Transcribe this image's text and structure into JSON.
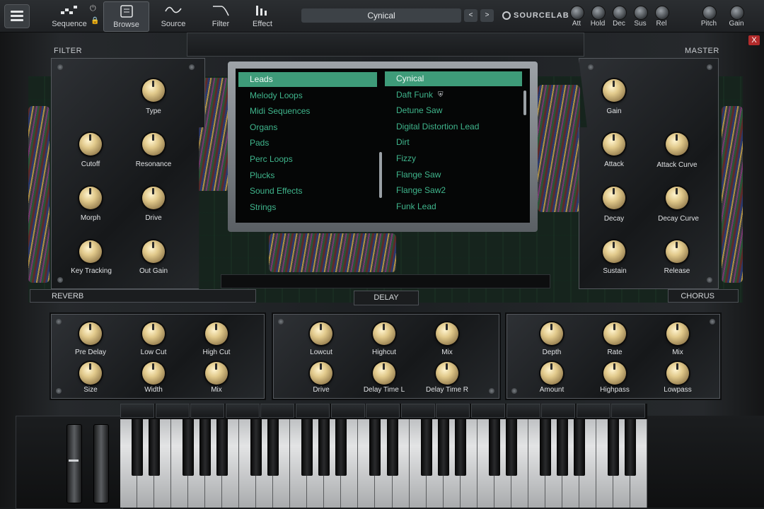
{
  "toolbar": {
    "nav": [
      {
        "label": "Sequence",
        "icon": "sequence-icon"
      },
      {
        "label": "Browse",
        "icon": "browse-icon",
        "active": true
      },
      {
        "label": "Source",
        "icon": "sine-wave-icon"
      },
      {
        "label": "Filter",
        "icon": "filter-curve-icon"
      },
      {
        "label": "Effect",
        "icon": "effect-bars-icon"
      }
    ],
    "preset_name": "Cynical",
    "prev": "<",
    "next": ">",
    "brand": "SOURCELAB",
    "envelope": [
      "Att",
      "Hold",
      "Dec",
      "Sus",
      "Rel"
    ],
    "pitch": "Pitch",
    "gain": "Gain",
    "close": "X"
  },
  "sections": {
    "filter": "FILTER",
    "master": "MASTER",
    "reverb": "REVERB",
    "delay": "DELAY",
    "chorus": "CHORUS"
  },
  "filter_knobs": [
    "Type",
    "Cutoff",
    "Resonance",
    "Morph",
    "Drive",
    "Key Tracking",
    "Out Gain"
  ],
  "master_knobs": [
    "Gain",
    "Attack",
    "Attack Curve",
    "Decay",
    "Decay Curve",
    "Sustain",
    "Release"
  ],
  "reverb_knobs": [
    "Pre Delay",
    "Low Cut",
    "High Cut",
    "Size",
    "Width",
    "Mix"
  ],
  "delay_knobs": [
    "Lowcut",
    "Highcut",
    "Mix",
    "Drive",
    "Delay Time L",
    "Delay Time R"
  ],
  "chorus_knobs": [
    "Depth",
    "Rate",
    "Mix",
    "Amount",
    "Highpass",
    "Lowpass"
  ],
  "browser": {
    "categories": [
      "Leads",
      "Melody Loops",
      "Midi Sequences",
      "Organs",
      "Pads",
      "Perc Loops",
      "Plucks",
      "Sound Effects",
      "Strings"
    ],
    "selected_category": "Leads",
    "presets": [
      "Cynical",
      "Daft Funk",
      "Detune Saw",
      "Digital Distortion Lead",
      "Dirt",
      "Fizzy",
      "Flange Saw",
      "Flange Saw2",
      "Funk Lead"
    ],
    "selected_preset": "Cynical"
  }
}
